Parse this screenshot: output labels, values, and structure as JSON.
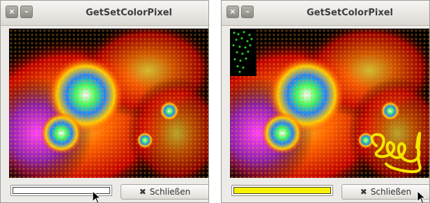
{
  "windows": [
    {
      "title": "GetSetColorPixel",
      "close_glyph": "×",
      "min_glyph": "–",
      "progress_fraction": 0,
      "progress_color": "#ffffff",
      "button_label": "Schließen",
      "button_icon": "close-x-icon",
      "has_drawing": false
    },
    {
      "title": "GetSetColorPixel",
      "close_glyph": "×",
      "min_glyph": "–",
      "progress_fraction": 1,
      "progress_color": "#f7f300",
      "button_label": "Schließen",
      "button_icon": "close-x-icon",
      "has_drawing": true,
      "drawing_colors": {
        "dots": "#22dd22",
        "scribble": "#f2e600"
      }
    }
  ]
}
